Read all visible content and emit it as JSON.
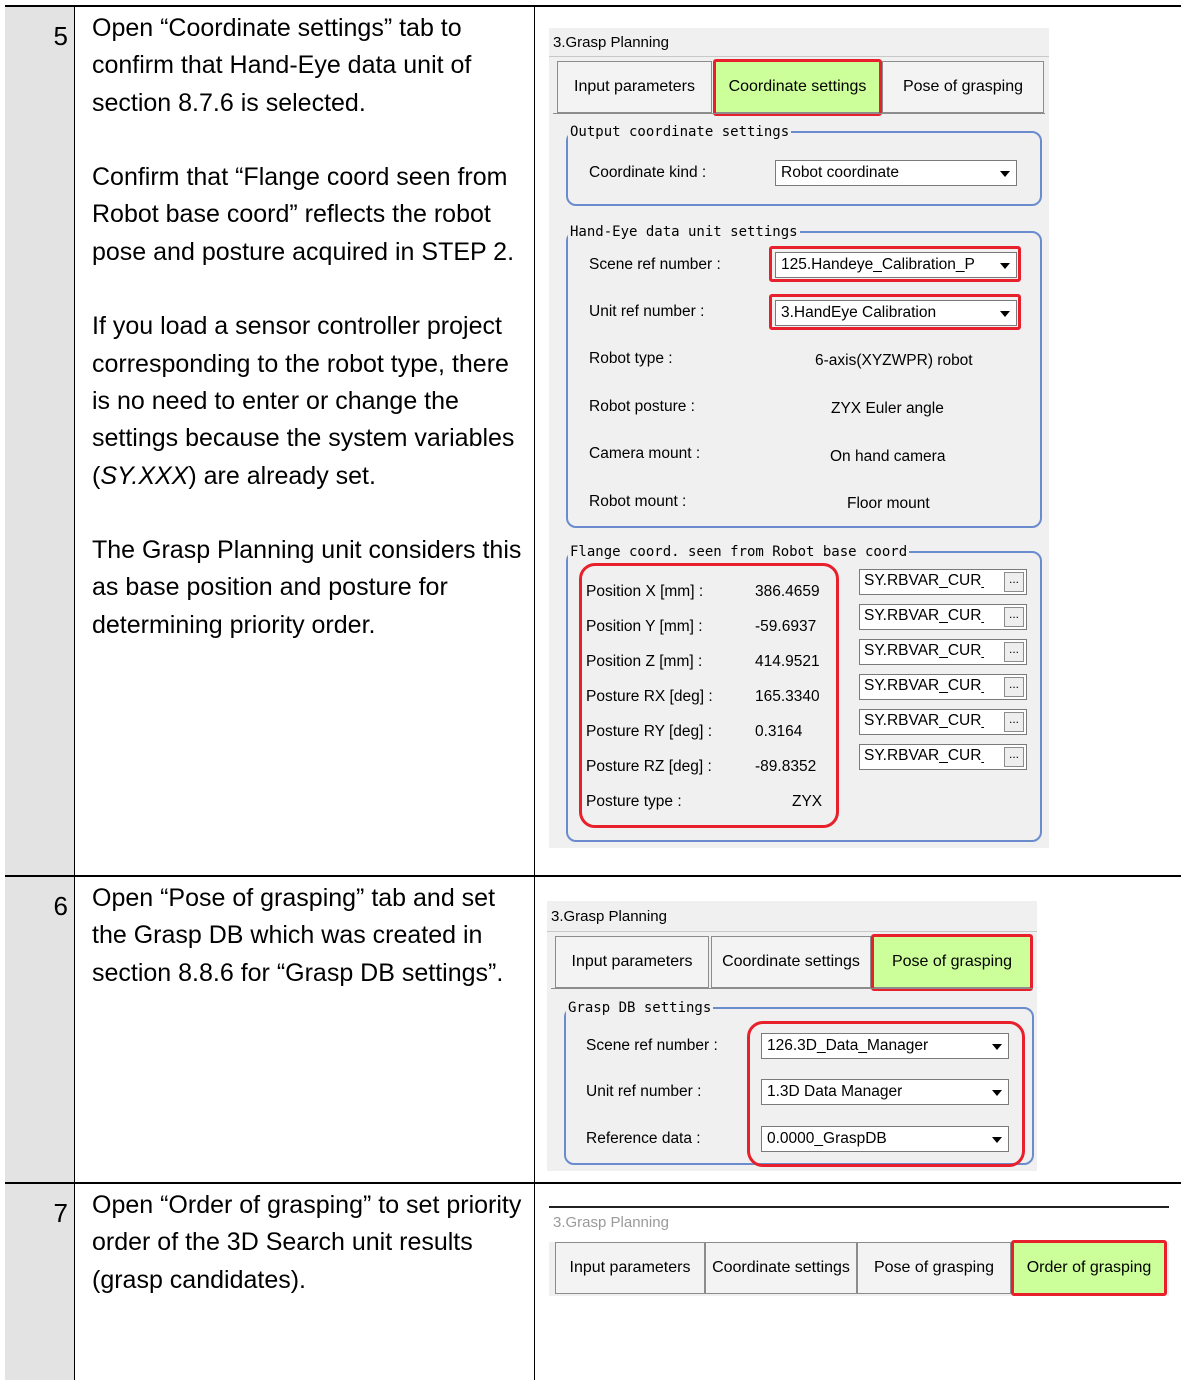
{
  "rows": [
    {
      "number": "5",
      "paragraphs": [
        "Open “Coordinate settings” tab to confirm that Hand-Eye data unit of section 8.7.6 is selected.",
        "Confirm that “Flange coord seen from Robot base coord” reflects the robot pose and posture acquired in STEP 2.",
        "The Grasp Planning unit considers this as base position and posture for determining priority order."
      ],
      "para_sensor": {
        "before": "If you load a sensor controller project corresponding to the robot type, there is no need to enter or change the settings because the system variables (",
        "italic": "SY.XXX",
        "after": ") are already set."
      },
      "screenshot": {
        "title": "3.Grasp Planning",
        "tabs": [
          "Input parameters",
          "Coordinate settings",
          "Pose of grasping"
        ],
        "selected_tab": "Coordinate settings",
        "output_group": {
          "legend": "Output coordinate settings",
          "coordinate_kind_label": "Coordinate kind :",
          "coordinate_kind_value": "Robot coordinate"
        },
        "handeye_group": {
          "legend": "Hand-Eye data unit settings",
          "scene_ref_label": "Scene ref number :",
          "scene_ref_value": "125.Handeye_Calibration_P",
          "unit_ref_label": "Unit ref number :",
          "unit_ref_value": "3.HandEye Calibration",
          "robot_type_label": "Robot type :",
          "robot_type_value": "6-axis(XYZWPR) robot",
          "robot_posture_label": "Robot posture :",
          "robot_posture_value": "ZYX Euler angle",
          "camera_mount_label": "Camera mount :",
          "camera_mount_value": "On hand camera",
          "robot_mount_label": "Robot mount :",
          "robot_mount_value": "Floor mount"
        },
        "flange_group": {
          "legend": "Flange coord. seen from Robot base coord",
          "rows": [
            {
              "label": "Position X [mm] :",
              "value": "386.4659",
              "ref": "SY.RBVAR_CUR_I"
            },
            {
              "label": "Position Y [mm] :",
              "value": "-59.6937",
              "ref": "SY.RBVAR_CUR_I"
            },
            {
              "label": "Position Z [mm] :",
              "value": "414.9521",
              "ref": "SY.RBVAR_CUR_I"
            },
            {
              "label": "Posture RX [deg] :",
              "value": "165.3340",
              "ref": "SY.RBVAR_CUR_I"
            },
            {
              "label": "Posture RY [deg] :",
              "value": "0.3164",
              "ref": "SY.RBVAR_CUR_I"
            },
            {
              "label": "Posture RZ [deg] :",
              "value": "-89.8352",
              "ref": "SY.RBVAR_CUR_I"
            }
          ],
          "posture_type_label": "Posture type :",
          "posture_type_value": "ZYX",
          "ref_button": "..."
        }
      }
    },
    {
      "number": "6",
      "paragraphs": [
        "Open “Pose of grasping” tab and set the Grasp DB which was created in section 8.8.6 for “Grasp DB settings”."
      ],
      "screenshot": {
        "title": "3.Grasp Planning",
        "tabs": [
          "Input parameters",
          "Coordinate settings",
          "Pose of grasping"
        ],
        "selected_tab": "Pose of grasping",
        "grasp_group": {
          "legend": "Grasp DB settings",
          "scene_ref_label": "Scene ref number :",
          "scene_ref_value": "126.3D_Data_Manager",
          "unit_ref_label": "Unit ref number :",
          "unit_ref_value": "1.3D Data Manager",
          "reference_label": "Reference data :",
          "reference_value": "0.0000_GraspDB"
        }
      }
    },
    {
      "number": "7",
      "paragraphs": [
        "Open “Order of grasping” to set priority order of the 3D Search unit results (grasp candidates)."
      ],
      "screenshot": {
        "title": "3.Grasp Planning",
        "tabs": [
          "Input parameters",
          "Coordinate settings",
          "Pose of grasping",
          "Order of grasping"
        ],
        "selected_tab": "Order of grasping"
      }
    }
  ],
  "colors": {
    "highlight_red": "#e8202b",
    "selected_tab_green": "#ccff99",
    "group_border_blue": "#6a8ccf",
    "step_cell_gray": "#e3e3e3"
  }
}
